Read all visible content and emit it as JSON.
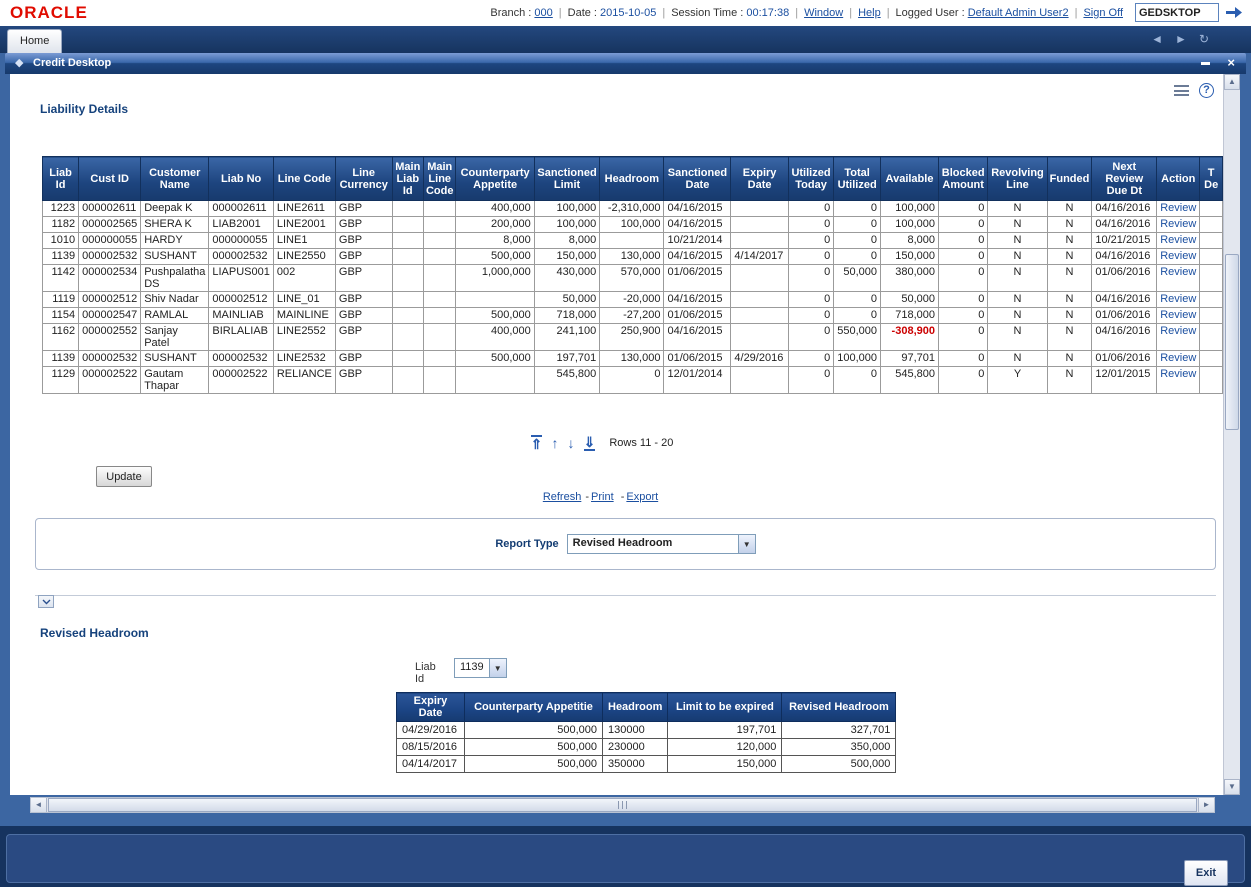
{
  "topbar": {
    "logo": "ORACLE",
    "items": [
      {
        "label": "Branch :",
        "text": "000",
        "link": true,
        "name": "branch-link"
      },
      {
        "label": "Date :",
        "text": "2015-10-05",
        "link": false,
        "name": "date-value"
      },
      {
        "label": "Session Time :",
        "text": "00:17:38",
        "link": false,
        "name": "session-time-value"
      },
      {
        "label": "",
        "text": "Window",
        "link": true,
        "name": "window-link"
      },
      {
        "label": "",
        "text": "Help",
        "link": true,
        "name": "help-link"
      },
      {
        "label": "Logged User :",
        "text": "Default Admin User2",
        "link": true,
        "name": "logged-user-link"
      },
      {
        "label": "",
        "text": "Sign Off",
        "link": true,
        "name": "sign-off-link"
      }
    ],
    "workspace": "GEDSKTOP"
  },
  "tabs": {
    "home": "Home"
  },
  "window": {
    "title": "Credit Desktop"
  },
  "icons": {
    "diamond": "◆",
    "close": "×",
    "help": "?",
    "nav_back": "◄",
    "nav_forward": "►",
    "refresh": "↻",
    "page_first": "⇑",
    "page_prev": "↑",
    "page_next": "↓",
    "page_last": "⇓",
    "dropdown": "▼",
    "scroll_up": "▲",
    "scroll_down": "▼",
    "scroll_left": "◄",
    "scroll_right": "►"
  },
  "liability": {
    "title": "Liability Details",
    "columns": [
      "Liab Id",
      "Cust ID",
      "Customer Name",
      "Liab No",
      "Line Code",
      "Line Currency",
      "Main Liab Id",
      "Main Line Code",
      "Counterparty Appetite",
      "Sanctioned Limit",
      "Headroom",
      "Sanctioned Date",
      "Expiry Date",
      "Utilized Today",
      "Total Utilized",
      "Available",
      "Blocked Amount",
      "Revolving Line",
      "Funded",
      "Next Review Due Dt",
      "Action",
      "T De"
    ],
    "rows": [
      [
        "1223",
        "000002611",
        "Deepak K",
        "000002611",
        "LINE2611",
        "GBP",
        "",
        "",
        "400,000",
        "100,000",
        "-2,310,000",
        "04/16/2015",
        "",
        "0",
        "0",
        "100,000",
        "0",
        "N",
        "N",
        "04/16/2016",
        "Review",
        ""
      ],
      [
        "1182",
        "000002565",
        "SHERA K",
        "LIAB2001",
        "LINE2001",
        "GBP",
        "",
        "",
        "200,000",
        "100,000",
        "100,000",
        "04/16/2015",
        "",
        "0",
        "0",
        "100,000",
        "0",
        "N",
        "N",
        "04/16/2016",
        "Review",
        ""
      ],
      [
        "1010",
        "000000055",
        "HARDY",
        "000000055",
        "LINE1",
        "GBP",
        "",
        "",
        "8,000",
        "8,000",
        "",
        "10/21/2014",
        "",
        "0",
        "0",
        "8,000",
        "0",
        "N",
        "N",
        "10/21/2015",
        "Review",
        ""
      ],
      [
        "1139",
        "000002532",
        "SUSHANT",
        "000002532",
        "LINE2550",
        "GBP",
        "",
        "",
        "500,000",
        "150,000",
        "130,000",
        "04/16/2015",
        "4/14/2017",
        "0",
        "0",
        "150,000",
        "0",
        "N",
        "N",
        "04/16/2016",
        "Review",
        ""
      ],
      [
        "1142",
        "000002534",
        "Pushpalatha DS",
        "LIAPUS001",
        "002",
        "GBP",
        "",
        "",
        "1,000,000",
        "430,000",
        "570,000",
        "01/06/2015",
        "",
        "0",
        "50,000",
        "380,000",
        "0",
        "N",
        "N",
        "01/06/2016",
        "Review",
        ""
      ],
      [
        "1119",
        "000002512",
        "Shiv Nadar",
        "000002512",
        "LINE_01",
        "GBP",
        "",
        "",
        "",
        "50,000",
        "-20,000",
        "04/16/2015",
        "",
        "0",
        "0",
        "50,000",
        "0",
        "N",
        "N",
        "04/16/2016",
        "Review",
        ""
      ],
      [
        "1154",
        "000002547",
        "RAMLAL",
        "MAINLIAB",
        "MAINLINE",
        "GBP",
        "",
        "",
        "500,000",
        "718,000",
        "-27,200",
        "01/06/2015",
        "",
        "0",
        "0",
        "718,000",
        "0",
        "N",
        "N",
        "01/06/2016",
        "Review",
        ""
      ],
      [
        "1162",
        "000002552",
        "Sanjay Patel",
        "BIRLALIAB",
        "LINE2552",
        "GBP",
        "",
        "",
        "400,000",
        "241,100",
        "250,900",
        "04/16/2015",
        "",
        "0",
        "550,000",
        "-308,900",
        "0",
        "N",
        "N",
        "04/16/2016",
        "Review",
        ""
      ],
      [
        "1139",
        "000002532",
        "SUSHANT",
        "000002532",
        "LINE2532",
        "GBP",
        "",
        "",
        "500,000",
        "197,701",
        "130,000",
        "01/06/2015",
        "4/29/2016",
        "0",
        "100,000",
        "97,701",
        "0",
        "N",
        "N",
        "01/06/2016",
        "Review",
        ""
      ],
      [
        "1129",
        "000002522",
        "Gautam Thapar",
        "000002522",
        "RELIANCE",
        "GBP",
        "",
        "",
        "",
        "545,800",
        "0",
        "12/01/2014",
        "",
        "0",
        "0",
        "545,800",
        "0",
        "Y",
        "N",
        "12/01/2015",
        "Review",
        ""
      ]
    ],
    "rows_label": "Rows 11 - 20",
    "update_label": "Update",
    "links": {
      "refresh": "Refresh",
      "print": "Print",
      "export": "Export",
      "separator": "-"
    }
  },
  "report_type": {
    "label": "Report Type",
    "value": "Revised Headroom"
  },
  "revised_headroom": {
    "title": "Revised Headroom",
    "liab_id_label": "Liab Id",
    "liab_id_value": "1139",
    "columns": [
      "Expiry Date",
      "Counterparty Appetitie",
      "Headroom",
      "Limit to be expired",
      "Revised Headroom"
    ],
    "rows": [
      [
        "04/29/2016",
        "500,000",
        "130000",
        "197,701",
        "327,701"
      ],
      [
        "08/15/2016",
        "500,000",
        "230000",
        "120,000",
        "350,000"
      ],
      [
        "04/14/2017",
        "500,000",
        "350000",
        "150,000",
        "500,000"
      ]
    ]
  },
  "footer": {
    "exit_label": "Exit"
  }
}
